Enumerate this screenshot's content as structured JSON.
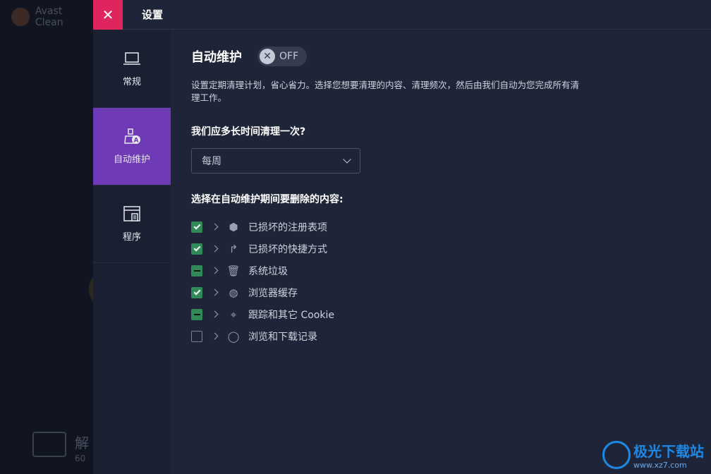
{
  "background": {
    "app_name": "Avast Clean",
    "bottom_title": "解",
    "bottom_sub": "60"
  },
  "titlebar": {
    "title": "设置",
    "close_icon": "close-icon"
  },
  "sidebar": {
    "items": [
      {
        "label": "常规",
        "icon": "laptop-icon",
        "active": false
      },
      {
        "label": "自动维护",
        "icon": "auto-maintenance-icon",
        "active": true
      },
      {
        "label": "程序",
        "icon": "programs-icon",
        "active": false
      }
    ]
  },
  "auto": {
    "title": "自动维护",
    "toggle_label": "OFF",
    "toggle_state": "off",
    "description": "设置定期清理计划，省心省力。选择您想要清理的内容、清理频次，然后由我们自动为您完成所有清理工作。",
    "frequency_question": "我们应多长时间清理一次?",
    "frequency_value": "每周",
    "items_title": "选择在自动维护期间要删除的内容:",
    "items": [
      {
        "label": "已损坏的注册表项",
        "state": "checked",
        "icon": "registry-icon"
      },
      {
        "label": "已损坏的快捷方式",
        "state": "checked",
        "icon": "shortcut-icon"
      },
      {
        "label": "系统垃圾",
        "state": "partial",
        "icon": "trash-icon"
      },
      {
        "label": "浏览器缓存",
        "state": "checked",
        "icon": "globe-icon"
      },
      {
        "label": "跟踪和其它 Cookie",
        "state": "partial",
        "icon": "crosshair-icon"
      },
      {
        "label": "浏览和下载记录",
        "state": "empty",
        "icon": "chat-icon"
      }
    ]
  },
  "watermark": {
    "title": "极光下载站",
    "url": "www.xz7.com"
  },
  "colors": {
    "accent_close": "#e0245e",
    "accent_active": "#6f3ab5",
    "checkbox": "#2f8a57"
  }
}
